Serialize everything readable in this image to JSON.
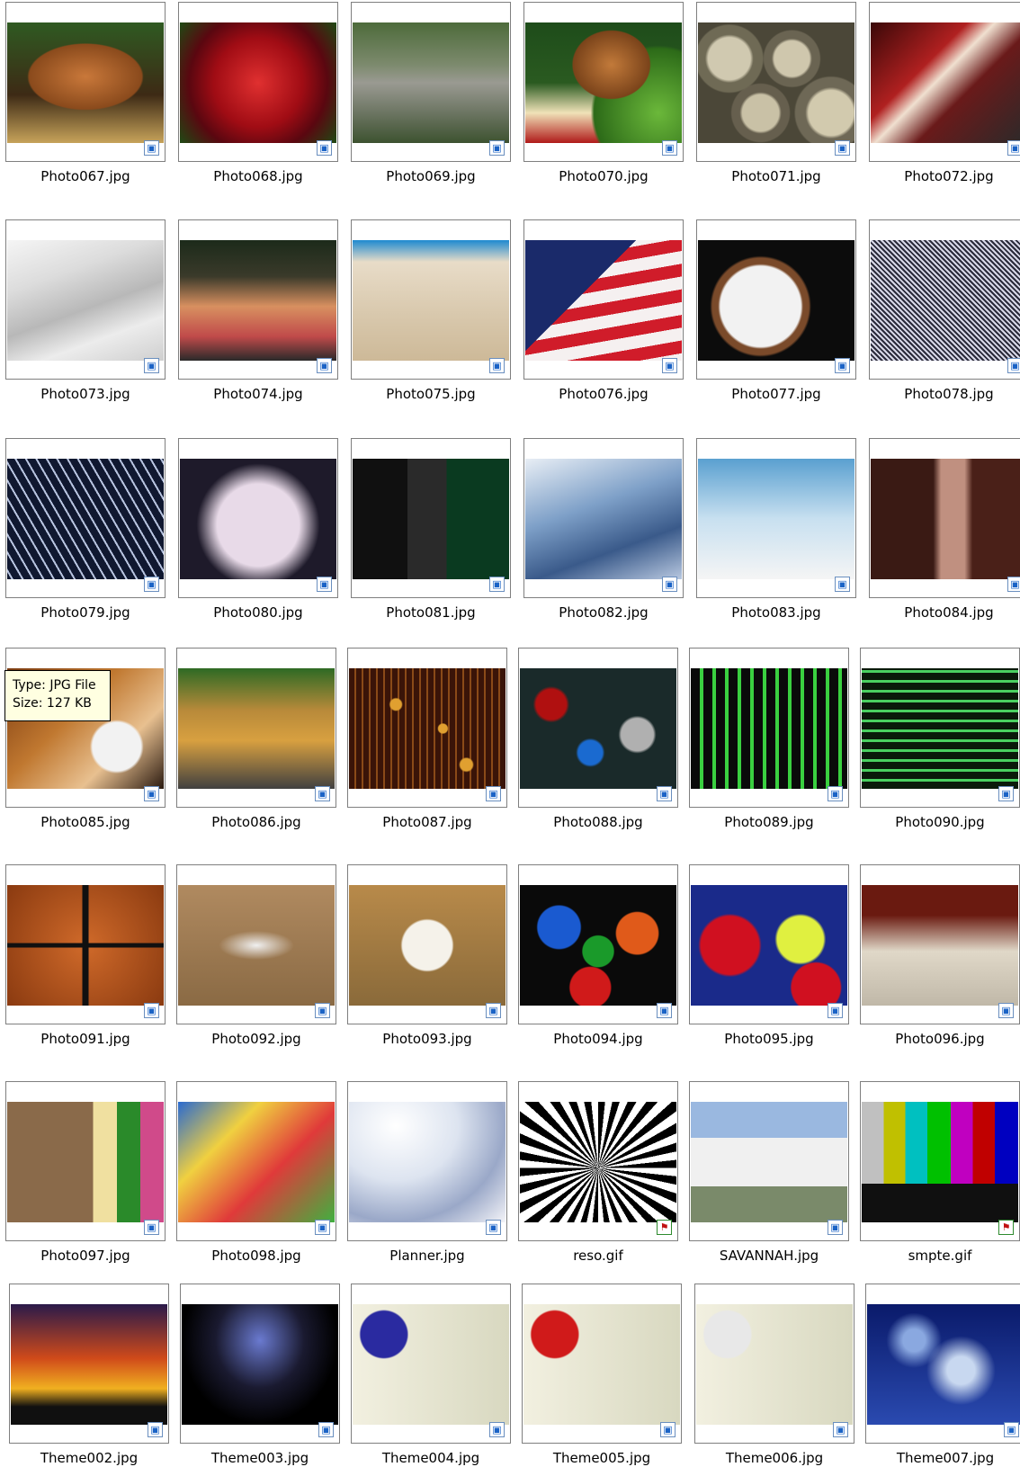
{
  "tooltip": {
    "type_line": "Type: JPG File",
    "size_line": "Size: 127 KB"
  },
  "files": [
    {
      "name": "Photo067.jpg",
      "kind": "jpg",
      "thumb": "bread"
    },
    {
      "name": "Photo068.jpg",
      "kind": "jpg",
      "thumb": "rose"
    },
    {
      "name": "Photo069.jpg",
      "kind": "jpg",
      "thumb": "highway"
    },
    {
      "name": "Photo070.jpg",
      "kind": "jpg",
      "thumb": "food"
    },
    {
      "name": "Photo071.jpg",
      "kind": "jpg",
      "thumb": "pipes"
    },
    {
      "name": "Photo072.jpg",
      "kind": "jpg",
      "thumb": "tools"
    },
    {
      "name": "Photo073.jpg",
      "kind": "jpg",
      "thumb": "phone"
    },
    {
      "name": "Photo074.jpg",
      "kind": "jpg",
      "thumb": "candles"
    },
    {
      "name": "Photo075.jpg",
      "kind": "jpg",
      "thumb": "bird"
    },
    {
      "name": "Photo076.jpg",
      "kind": "jpg",
      "thumb": "flag"
    },
    {
      "name": "Photo077.jpg",
      "kind": "jpg",
      "thumb": "watch"
    },
    {
      "name": "Photo078.jpg",
      "kind": "jpg",
      "thumb": "engraving"
    },
    {
      "name": "Photo079.jpg",
      "kind": "jpg",
      "thumb": "clips"
    },
    {
      "name": "Photo080.jpg",
      "kind": "jpg",
      "thumb": "washington"
    },
    {
      "name": "Photo081.jpg",
      "kind": "jpg",
      "thumb": "chip"
    },
    {
      "name": "Photo082.jpg",
      "kind": "jpg",
      "thumb": "tower"
    },
    {
      "name": "Photo083.jpg",
      "kind": "jpg",
      "thumb": "glass"
    },
    {
      "name": "Photo084.jpg",
      "kind": "jpg",
      "thumb": "copper"
    },
    {
      "name": "Photo085.jpg",
      "kind": "jpg",
      "thumb": "baseball-glove"
    },
    {
      "name": "Photo086.jpg",
      "kind": "jpg",
      "thumb": "loader"
    },
    {
      "name": "Photo087.jpg",
      "kind": "jpg",
      "thumb": "circuit-brown"
    },
    {
      "name": "Photo088.jpg",
      "kind": "jpg",
      "thumb": "components"
    },
    {
      "name": "Photo089.jpg",
      "kind": "jpg",
      "thumb": "circuit-green"
    },
    {
      "name": "Photo090.jpg",
      "kind": "jpg",
      "thumb": "circuit-green2"
    },
    {
      "name": "Photo091.jpg",
      "kind": "jpg",
      "thumb": "basketball"
    },
    {
      "name": "Photo092.jpg",
      "kind": "jpg",
      "thumb": "plane"
    },
    {
      "name": "Photo093.jpg",
      "kind": "jpg",
      "thumb": "baseball"
    },
    {
      "name": "Photo094.jpg",
      "kind": "jpg",
      "thumb": "balloons"
    },
    {
      "name": "Photo095.jpg",
      "kind": "jpg",
      "thumb": "balloons2"
    },
    {
      "name": "Photo096.jpg",
      "kind": "jpg",
      "thumb": "coffee"
    },
    {
      "name": "Photo097.jpg",
      "kind": "jpg",
      "thumb": "blocks"
    },
    {
      "name": "Photo098.jpg",
      "kind": "jpg",
      "thumb": "blocks2"
    },
    {
      "name": "Planner.jpg",
      "kind": "jpg",
      "thumb": "planner"
    },
    {
      "name": "reso.gif",
      "kind": "gif",
      "thumb": "starburst"
    },
    {
      "name": "SAVANNAH.jpg",
      "kind": "jpg",
      "thumb": "house"
    },
    {
      "name": "smpte.gif",
      "kind": "gif",
      "thumb": "smpte"
    },
    {
      "name": "Theme002.jpg",
      "kind": "jpg",
      "thumb": "sunset"
    },
    {
      "name": "Theme003.jpg",
      "kind": "jpg",
      "thumb": "lightning"
    },
    {
      "name": "Theme004.jpg",
      "kind": "jpg",
      "thumb": "ribbon-blue"
    },
    {
      "name": "Theme005.jpg",
      "kind": "jpg",
      "thumb": "ribbon-red"
    },
    {
      "name": "Theme006.jpg",
      "kind": "jpg",
      "thumb": "ribbon-white"
    },
    {
      "name": "Theme007.jpg",
      "kind": "jpg",
      "thumb": "snowflakes"
    }
  ]
}
